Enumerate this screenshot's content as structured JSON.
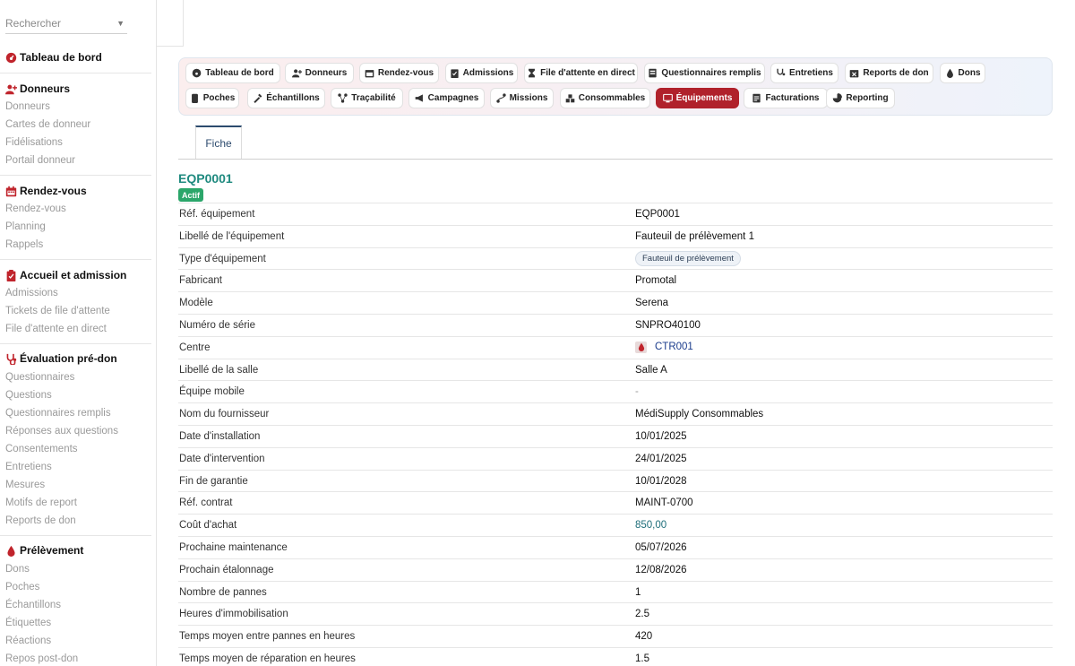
{
  "sidebar": {
    "search_placeholder": "Rechercher",
    "dashboard": "Tableau de bord",
    "sections": [
      {
        "title": "Donneurs",
        "items": [
          "Donneurs",
          "Cartes de donneur",
          "Fidélisations",
          "Portail donneur"
        ]
      },
      {
        "title": "Rendez-vous",
        "items": [
          "Rendez-vous",
          "Planning",
          "Rappels"
        ]
      },
      {
        "title": "Accueil et admission",
        "items": [
          "Admissions",
          "Tickets de file d'attente",
          "File d'attente en direct"
        ]
      },
      {
        "title": "Évaluation pré-don",
        "items": [
          "Questionnaires",
          "Questions",
          "Questionnaires remplis",
          "Réponses aux questions",
          "Consentements",
          "Entretiens",
          "Mesures",
          "Motifs de report",
          "Reports de don"
        ]
      },
      {
        "title": "Prélèvement",
        "items": [
          "Dons",
          "Poches",
          "Échantillons",
          "Étiquettes",
          "Réactions",
          "Repos post-don"
        ]
      }
    ]
  },
  "tabs": [
    {
      "label": "Tableau de bord",
      "icon": "gauge-icon"
    },
    {
      "label": "Donneurs",
      "icon": "user-plus-icon"
    },
    {
      "label": "Rendez-vous",
      "icon": "calendar-icon"
    },
    {
      "label": "Admissions",
      "icon": "clipboard-icon"
    },
    {
      "label": "File d'attente en direct",
      "icon": "hourglass-icon"
    },
    {
      "label": "Questionnaires remplis",
      "icon": "form-icon"
    },
    {
      "label": "Entretiens",
      "icon": "stethoscope-icon"
    },
    {
      "label": "Reports de don",
      "icon": "calendar-x-icon"
    },
    {
      "label": "Dons",
      "icon": "drop-icon"
    },
    {
      "label": "Poches",
      "icon": "bag-icon"
    },
    {
      "label": "Échantillons",
      "icon": "pipette-icon"
    },
    {
      "label": "Traçabilité",
      "icon": "network-icon"
    },
    {
      "label": "Campagnes",
      "icon": "megaphone-icon"
    },
    {
      "label": "Missions",
      "icon": "route-icon"
    },
    {
      "label": "Consommables",
      "icon": "boxes-icon"
    },
    {
      "label": "Équipements",
      "icon": "monitor-icon",
      "active": true
    },
    {
      "label": "Facturations",
      "icon": "invoice-icon"
    },
    {
      "label": "Reporting",
      "icon": "pie-icon"
    }
  ],
  "subtab": "Fiche",
  "record": {
    "title": "EQP0001",
    "status": "Actif",
    "fields": [
      {
        "label": "Réf. équipement",
        "value": "EQP0001"
      },
      {
        "label": "Libellé de l'équipement",
        "value": "Fauteuil de prélèvement 1"
      },
      {
        "label": "Type d'équipement",
        "value": "Fauteuil de prélèvement",
        "kind": "chip"
      },
      {
        "label": "Fabricant",
        "value": "Promotal"
      },
      {
        "label": "Modèle",
        "value": "Serena"
      },
      {
        "label": "Numéro de série",
        "value": "SNPRO40100"
      },
      {
        "label": "Centre",
        "value": "CTR001",
        "kind": "link"
      },
      {
        "label": "Libellé de la salle",
        "value": "Salle A"
      },
      {
        "label": "Équipe mobile",
        "value": "-",
        "kind": "dash"
      },
      {
        "label": "Nom du fournisseur",
        "value": "MédiSupply Consommables"
      },
      {
        "label": "Date d'installation",
        "value": "10/01/2025"
      },
      {
        "label": "Date d'intervention",
        "value": "24/01/2025"
      },
      {
        "label": "Fin de garantie",
        "value": "10/01/2028"
      },
      {
        "label": "Réf. contrat",
        "value": "MAINT-0700"
      },
      {
        "label": "Coût d'achat",
        "value": "850,00",
        "kind": "money"
      },
      {
        "label": "Prochaine maintenance",
        "value": "05/07/2026"
      },
      {
        "label": "Prochain étalonnage",
        "value": "12/08/2026"
      },
      {
        "label": "Nombre de pannes",
        "value": "1"
      },
      {
        "label": "Heures d'immobilisation",
        "value": "2.5"
      },
      {
        "label": "Temps moyen entre pannes en heures",
        "value": "420"
      },
      {
        "label": "Temps moyen de réparation en heures",
        "value": "1.5"
      }
    ]
  },
  "colors": {
    "accent": "#b0212b",
    "title": "#1f8a7f",
    "badge": "#2ba66a",
    "link": "#1b3c8c"
  }
}
